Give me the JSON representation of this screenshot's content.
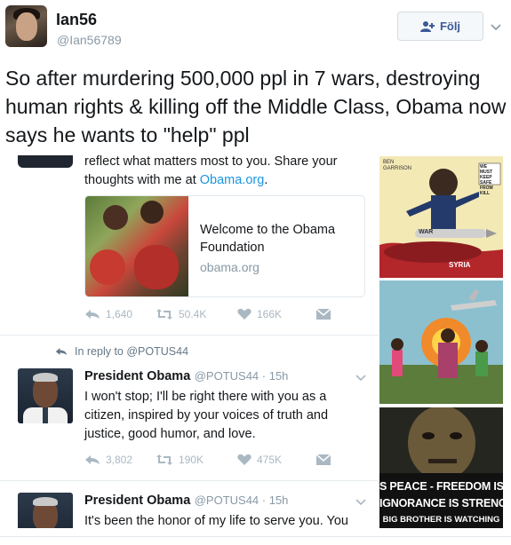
{
  "header": {
    "display_name": "Ian56",
    "handle": "@Ian56789",
    "follow_label": "Följ"
  },
  "tweet": {
    "text": "So after murdering 500,000 ppl in 7 wars, destroying human rights & killing off the Middle Class, Obama now says he wants to \"help\" ppl"
  },
  "embedded": {
    "snippet_line1": "reflect what matters most to you. Share your",
    "snippet_line2_prefix": "thoughts with me at ",
    "snippet_link": "Obama.org",
    "snippet_suffix": ".",
    "card": {
      "title": "Welcome to the Obama Foundation",
      "domain": "obama.org"
    },
    "actions1": {
      "retweets": "1,640",
      "likes": "50.4K",
      "replies_or_likes": "166K"
    },
    "reply_to": "In reply to @POTUS44",
    "tweet2": {
      "name": "President Obama",
      "meta": "@POTUS44 · 15h",
      "text": "I won't stop; I'll be right there with you as a citizen, inspired by your voices of truth and justice, good humor, and love.",
      "actions": {
        "replies": "3,802",
        "retweets": "190K",
        "likes": "475K"
      }
    },
    "tweet3": {
      "name": "President Obama",
      "meta": "@POTUS44 · 15h",
      "text": "It's been the honor of my life to serve you. You"
    }
  },
  "right_images": {
    "cartoon1": {
      "signature": "BEN GARRISON",
      "speech": "WE MUST KEEP SAFE FROM KILL",
      "label": "SYRIA",
      "missile": "WAR"
    },
    "poster": {
      "line1": "S PEACE - FREEDOM IS S",
      "line2": "IGNORANCE IS STRENGT",
      "line3": "BIG BROTHER IS WATCHING"
    }
  }
}
